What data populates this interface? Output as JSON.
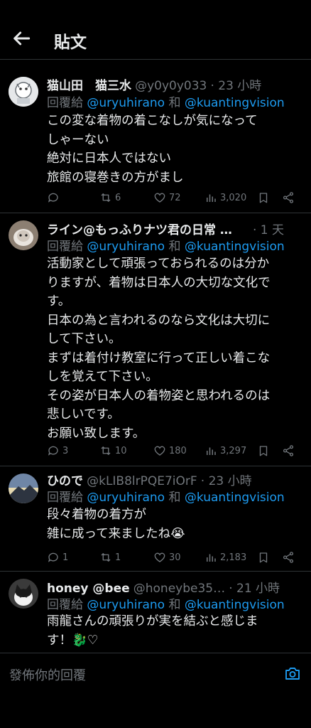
{
  "header": {
    "title": "貼文"
  },
  "replying_label": "回覆給",
  "conjunction": "和",
  "replies": [
    {
      "name": "猫山田　猫三水",
      "handle": "@y0y0y033",
      "time": "· 23 小時",
      "mentions": [
        "@uryuhirano",
        "@kuantingvision"
      ],
      "lines": [
        "この変な着物の着こなしが気になって",
        "しゃーない",
        "絶対に日本人ではない",
        "旅館の寝巻きの方がまし"
      ],
      "stats": {
        "replies": "",
        "reposts": "6",
        "likes": "72",
        "views": "3,020"
      }
    },
    {
      "name": "ライン@もっふりナツ君の日常 …",
      "handle": "",
      "time": "· 1 天",
      "mentions": [
        "@uryuhirano",
        "@kuantingvision"
      ],
      "lines": [
        "活動家として頑張っておられるのは分か",
        "りますが、着物は日本人の大切な文化で",
        "す。",
        "日本の為と言われるのなら文化は大切に",
        "して下さい。",
        "まずは着付け教室に行って正しい着こな",
        "しを覚えて下さい。",
        "その姿が日本人の着物姿と思われるのは",
        "悲しいです。",
        "お願い致します。"
      ],
      "stats": {
        "replies": "3",
        "reposts": "10",
        "likes": "180",
        "views": "3,297"
      }
    },
    {
      "name": "ひので",
      "handle": "@kLIB8lrPQE7iOrF",
      "time": "· 23 小時",
      "mentions": [
        "@uryuhirano",
        "@kuantingvision"
      ],
      "lines": [
        "段々着物の着方が",
        "雑に成って来ましたね😭"
      ],
      "stats": {
        "replies": "1",
        "reposts": "1",
        "likes": "30",
        "views": "2,183"
      }
    },
    {
      "name": "honey @bee",
      "handle": "@honeybe35…",
      "time": "· 21 小時",
      "mentions": [
        "@uryuhirano",
        "@kuantingvision"
      ],
      "lines": [
        "雨龍さんの頑張りが実を結ぶと感じま",
        "す！🐉♡"
      ],
      "stats": {
        "replies": "",
        "reposts": "",
        "likes": "",
        "views": ""
      }
    }
  ],
  "composer": {
    "placeholder": "發佈你的回覆"
  },
  "colors": {
    "background": "#000000",
    "text": "#e7e9ea",
    "muted": "#71767b",
    "accent": "#1d9bf0",
    "divider": "#2f3336"
  },
  "icons": [
    "back-arrow-icon",
    "reply-icon",
    "repost-icon",
    "like-icon",
    "views-icon",
    "bookmark-icon",
    "share-icon",
    "camera-icon"
  ]
}
